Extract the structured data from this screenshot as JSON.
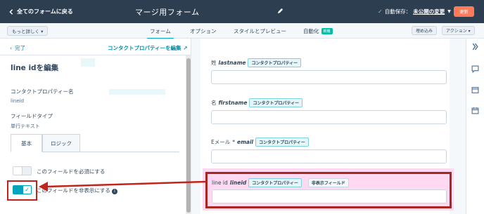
{
  "topbar": {
    "back_label": "全てのフォームに戻る",
    "form_title": "マージ用フォーム",
    "autosave_label": "自動保存：",
    "autosave_status": "未公開の変更",
    "update_button": "更新"
  },
  "subbar": {
    "more_label": "もっと詳しく ▾",
    "tabs": [
      {
        "label": "フォーム"
      },
      {
        "label": "オプション"
      },
      {
        "label": "スタイルとプレビュー"
      },
      {
        "label": "自動化"
      }
    ],
    "new_badge": "新機",
    "embed_label": "埋め込み",
    "action_label": "アクション ▾"
  },
  "leftpanel": {
    "done_label": "完了",
    "edit_property_link": "コンタクトプロパティーを編集",
    "heading": "line idを編集",
    "contact_property_label": "コンタクトプロパティー名",
    "contact_property_value": "lineid",
    "field_type_label": "フィールドタイプ",
    "field_type_value": "単行テキスト",
    "tab_basic": "基本",
    "tab_logic": "ロジック",
    "required_label": "このフィールドを必須にする",
    "hidden_label": "このフィールドを非表示にする"
  },
  "preview": {
    "fields": [
      {
        "label": "姓",
        "internal": "lastname",
        "badge": "コンタクトプロパティー",
        "required": ""
      },
      {
        "label": "名",
        "internal": "firstname",
        "badge": "コンタクトプロパティー",
        "required": ""
      },
      {
        "label": "Eメール",
        "internal": "email",
        "badge": "コンタクトプロパティー",
        "required": "*"
      },
      {
        "label": "line id",
        "internal": "lineid",
        "badge": "コンタクトプロパティー",
        "required": "",
        "hidden_badge": "非表示フィールド"
      }
    ]
  },
  "colors": {
    "topbar": "#2d3e50",
    "accent": "#00a4bd",
    "update": "#ff7a59",
    "highlight_red": "#c0241b"
  }
}
